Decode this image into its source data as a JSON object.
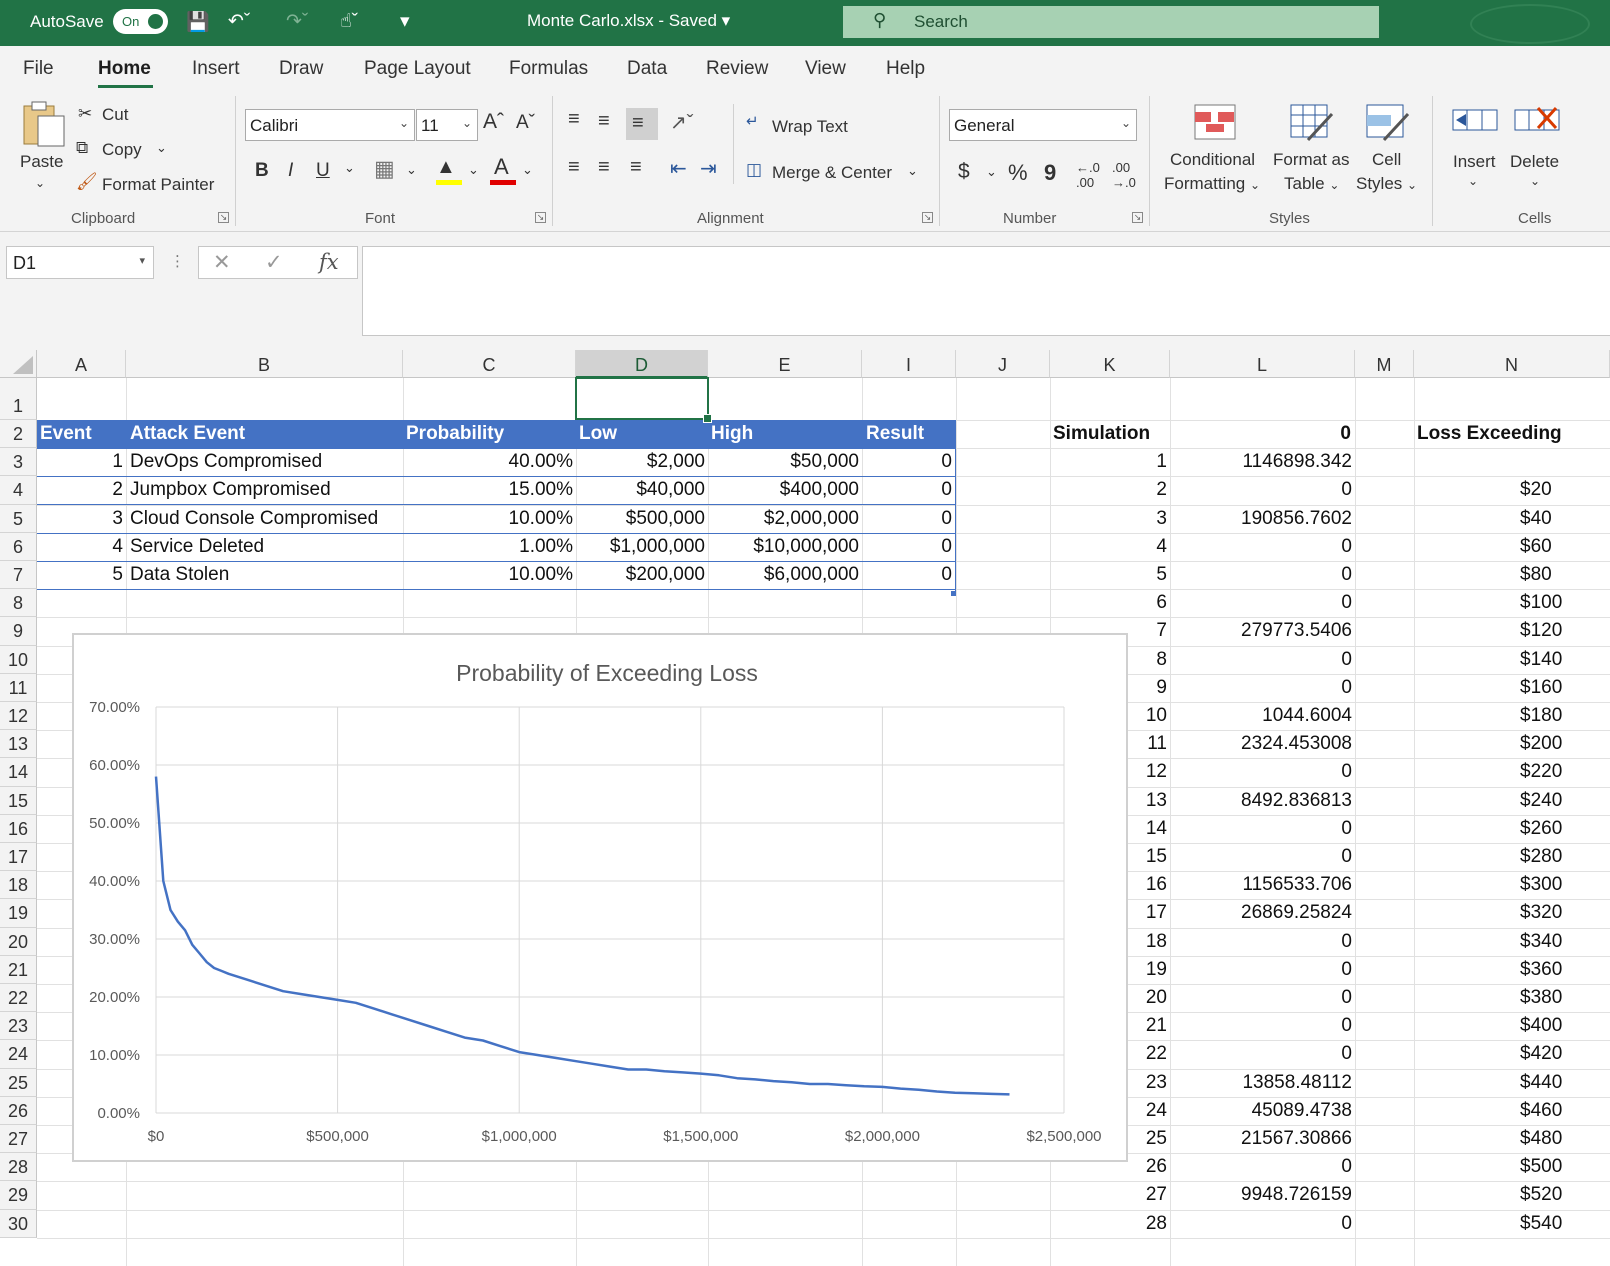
{
  "titlebar": {
    "autosave_label": "AutoSave",
    "autosave_state": "On",
    "document_title": "Monte Carlo.xlsx  -  Saved",
    "search_placeholder": "Search"
  },
  "menu_tabs": [
    "File",
    "Home",
    "Insert",
    "Draw",
    "Page Layout",
    "Formulas",
    "Data",
    "Review",
    "View",
    "Help"
  ],
  "active_tab": "Home",
  "ribbon": {
    "clipboard": {
      "paste": "Paste",
      "cut": "Cut",
      "copy": "Copy",
      "format_painter": "Format Painter",
      "group_label": "Clipboard"
    },
    "font": {
      "family": "Calibri",
      "size": "11",
      "bold": "B",
      "italic": "I",
      "underline": "U",
      "group_label": "Font"
    },
    "alignment": {
      "wrap_text": "Wrap Text",
      "merge_center": "Merge & Center",
      "group_label": "Alignment"
    },
    "number": {
      "format": "General",
      "currency": "$",
      "percent": "%",
      "comma": "9",
      "group_label": "Number"
    },
    "styles": {
      "conditional": "Conditional",
      "conditional2": "Formatting",
      "format_as": "Format as",
      "format_as2": "Table",
      "cell": "Cell",
      "cell2": "Styles",
      "group_label": "Styles"
    },
    "cells": {
      "insert": "Insert",
      "delete": "Delete",
      "group_label": "Cells"
    }
  },
  "formula_bar": {
    "name_box": "D1",
    "fx": "fx",
    "formula": ""
  },
  "columns": [
    "A",
    "B",
    "C",
    "D",
    "E",
    "I",
    "J",
    "K",
    "L",
    "M",
    "N"
  ],
  "selected_column": "D",
  "rows": [
    "1",
    "2",
    "3",
    "4",
    "5",
    "6",
    "7",
    "8",
    "9",
    "10",
    "11",
    "12",
    "13",
    "14",
    "15",
    "16",
    "17",
    "18",
    "19",
    "20",
    "21",
    "22",
    "23",
    "24",
    "25",
    "26",
    "27",
    "28",
    "29",
    "30"
  ],
  "table": {
    "headers": [
      "Event",
      "Attack Event",
      "Probability",
      "Low",
      "High",
      "Result"
    ],
    "rows": [
      [
        "1",
        "DevOps Compromised",
        "40.00%",
        "$2,000",
        "$50,000",
        "0"
      ],
      [
        "2",
        "Jumpbox Compromised",
        "15.00%",
        "$40,000",
        "$400,000",
        "0"
      ],
      [
        "3",
        "Cloud Console Compromised",
        "10.00%",
        "$500,000",
        "$2,000,000",
        "0"
      ],
      [
        "4",
        "Service Deleted",
        "1.00%",
        "$1,000,000",
        "$10,000,000",
        "0"
      ],
      [
        "5",
        "Data Stolen",
        "10.00%",
        "$200,000",
        "$6,000,000",
        "0"
      ]
    ]
  },
  "simulation": {
    "header_k": "Simulation",
    "header_l": "0",
    "header_n": "Loss Exceeding",
    "rows": [
      [
        "1",
        "1146898.342",
        ""
      ],
      [
        "2",
        "0",
        "$20"
      ],
      [
        "3",
        "190856.7602",
        "$40"
      ],
      [
        "4",
        "0",
        "$60"
      ],
      [
        "5",
        "0",
        "$80"
      ],
      [
        "6",
        "0",
        "$100"
      ],
      [
        "7",
        "279773.5406",
        "$120"
      ],
      [
        "8",
        "0",
        "$140"
      ],
      [
        "9",
        "0",
        "$160"
      ],
      [
        "10",
        "1044.6004",
        "$180"
      ],
      [
        "11",
        "2324.453008",
        "$200"
      ],
      [
        "12",
        "0",
        "$220"
      ],
      [
        "13",
        "8492.836813",
        "$240"
      ],
      [
        "14",
        "0",
        "$260"
      ],
      [
        "15",
        "0",
        "$280"
      ],
      [
        "16",
        "1156533.706",
        "$300"
      ],
      [
        "17",
        "26869.25824",
        "$320"
      ],
      [
        "18",
        "0",
        "$340"
      ],
      [
        "19",
        "0",
        "$360"
      ],
      [
        "20",
        "0",
        "$380"
      ],
      [
        "21",
        "0",
        "$400"
      ],
      [
        "22",
        "0",
        "$420"
      ],
      [
        "23",
        "13858.48112",
        "$440"
      ],
      [
        "24",
        "45089.4738",
        "$460"
      ],
      [
        "25",
        "21567.30866",
        "$480"
      ],
      [
        "26",
        "0",
        "$500"
      ],
      [
        "27",
        "9948.726159",
        "$520"
      ],
      [
        "28",
        "0",
        "$540"
      ]
    ]
  },
  "chart_data": {
    "type": "line",
    "title": "Probability of Exceeding Loss",
    "xlabel": "",
    "ylabel": "",
    "xlim": [
      0,
      2500000
    ],
    "ylim": [
      0,
      0.7
    ],
    "x_ticks": [
      "$0",
      "$500,000",
      "$1,000,000",
      "$1,500,000",
      "$2,000,000",
      "$2,500,000"
    ],
    "y_ticks": [
      "0.00%",
      "10.00%",
      "20.00%",
      "30.00%",
      "40.00%",
      "50.00%",
      "60.00%",
      "70.00%"
    ],
    "grid": true,
    "color": "#4472c4",
    "x": [
      0,
      20000,
      40000,
      60000,
      80000,
      100000,
      120000,
      140000,
      160000,
      180000,
      200000,
      250000,
      300000,
      350000,
      400000,
      450000,
      500000,
      550000,
      600000,
      650000,
      700000,
      750000,
      800000,
      850000,
      900000,
      950000,
      1000000,
      1050000,
      1100000,
      1150000,
      1200000,
      1250000,
      1300000,
      1350000,
      1400000,
      1450000,
      1500000,
      1550000,
      1600000,
      1650000,
      1700000,
      1750000,
      1800000,
      1850000,
      1900000,
      1950000,
      2000000,
      2050000,
      2100000,
      2150000,
      2200000,
      2250000,
      2300000,
      2350000
    ],
    "y": [
      0.58,
      0.4,
      0.35,
      0.33,
      0.315,
      0.29,
      0.275,
      0.26,
      0.25,
      0.245,
      0.24,
      0.23,
      0.22,
      0.21,
      0.205,
      0.2,
      0.195,
      0.19,
      0.18,
      0.17,
      0.16,
      0.15,
      0.14,
      0.13,
      0.125,
      0.115,
      0.105,
      0.1,
      0.095,
      0.09,
      0.085,
      0.08,
      0.075,
      0.075,
      0.072,
      0.07,
      0.068,
      0.065,
      0.06,
      0.058,
      0.055,
      0.053,
      0.05,
      0.05,
      0.048,
      0.046,
      0.045,
      0.042,
      0.04,
      0.037,
      0.035,
      0.034,
      0.033,
      0.032
    ]
  }
}
